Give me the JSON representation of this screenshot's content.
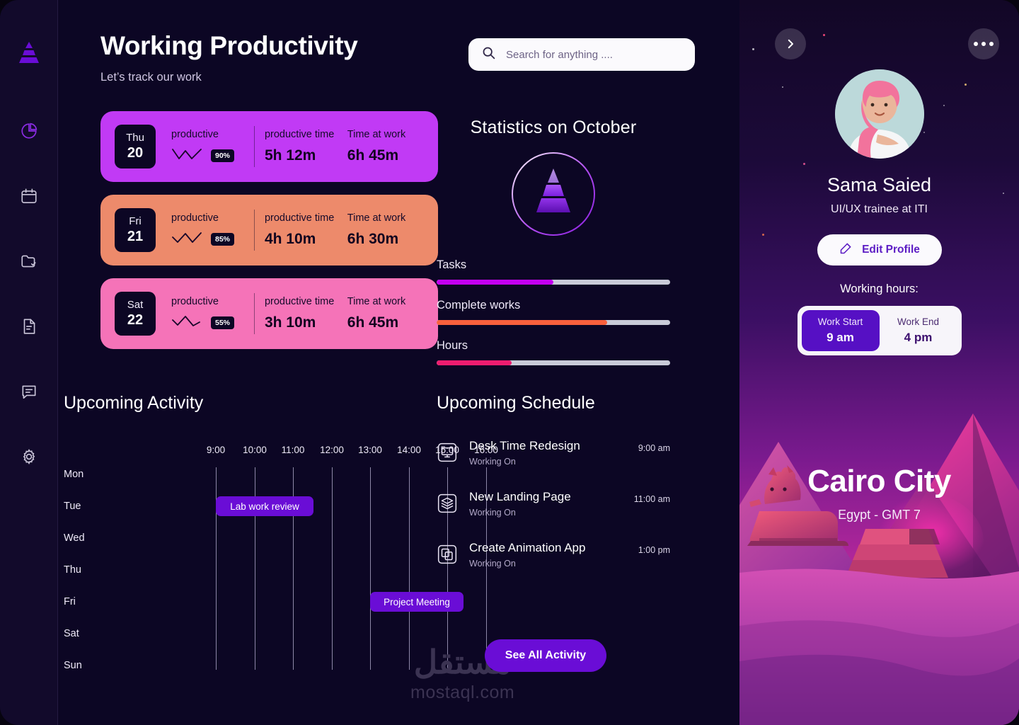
{
  "sidebar": {
    "logo_icon": "pyramid-logo-icon",
    "items": [
      {
        "icon": "pie-chart-icon",
        "active": true
      },
      {
        "icon": "calendar-icon",
        "active": false
      },
      {
        "icon": "folder-check-icon",
        "active": false
      },
      {
        "icon": "document-icon",
        "active": false
      },
      {
        "icon": "chat-icon",
        "active": false
      },
      {
        "icon": "gear-icon",
        "active": false
      }
    ]
  },
  "header": {
    "title": "Working Productivity",
    "subtitle": "Let’s track our work"
  },
  "search": {
    "placeholder": "Search for anything ....",
    "value": "",
    "icon": "search-icon"
  },
  "productivity_cards": [
    {
      "day": "Thu",
      "date": "20",
      "productive_label": "productive",
      "percent": "90%",
      "time_label": "productive time",
      "time_value": "5h 12m",
      "work_label": "Time at work",
      "work_value": "6h 45m",
      "color": "#C13AF5"
    },
    {
      "day": "Fri",
      "date": "21",
      "productive_label": "productive",
      "percent": "85%",
      "time_label": "productive time",
      "time_value": "4h 10m",
      "work_label": "Time at work",
      "work_value": "6h 30m",
      "color": "#ED8A6B"
    },
    {
      "day": "Sat",
      "date": "22",
      "productive_label": "productive",
      "percent": "55%",
      "time_label": "productive time",
      "time_value": "3h 10m",
      "work_label": "Time at work",
      "work_value": "6h 45m",
      "color": "#F573B8"
    }
  ],
  "statistics": {
    "title": "Statistics on October",
    "emblem_icon": "pyramid-emblem-icon",
    "bars": [
      {
        "label": "Tasks",
        "percent": 50,
        "color": "#C300F0"
      },
      {
        "label": "Complete works",
        "percent": 73,
        "color": "#F9603D"
      },
      {
        "label": "Hours",
        "percent": 32,
        "color": "#ED1C6F"
      }
    ],
    "track_color": "#C9CBD8"
  },
  "activity": {
    "title": "Upcoming Activity",
    "hours": [
      "9:00",
      "10:00",
      "11:00",
      "12:00",
      "13:00",
      "14:00",
      "15:00",
      "16:00"
    ],
    "days": [
      "Mon",
      "Tue",
      "Wed",
      "Thu",
      "Fri",
      "Sat",
      "Sun"
    ],
    "events": [
      {
        "label": "Lab work review",
        "day": "Tue",
        "start": "9:00",
        "end": "11:00"
      },
      {
        "label": "Project Meeting",
        "day": "Fri",
        "start": "13:00",
        "end": "15:00"
      }
    ],
    "event_color": "#6A0DD6"
  },
  "schedule": {
    "title": "Upcoming Schedule",
    "items": [
      {
        "name": "Desk Time Redesign",
        "status": "Working On",
        "time": "9:00 am",
        "icon": "monitor-icon"
      },
      {
        "name": "New Landing Page",
        "status": "Working On",
        "time": "11:00 am",
        "icon": "layers-icon"
      },
      {
        "name": "Create Animation App",
        "status": "Working On",
        "time": "1:00 pm",
        "icon": "copy-icon"
      }
    ],
    "see_all_label": "See All Activity"
  },
  "watermark": {
    "arabic": "مستقل",
    "latin": "mostaql.com"
  },
  "profile": {
    "forward_icon": "chevron-right-icon",
    "more_icon": "more-dots-icon",
    "avatar_icon": "user-avatar",
    "name": "Sama Saied",
    "role": "UI/UX trainee at  ITI",
    "edit_label": "Edit Profile",
    "edit_icon": "edit-pencil-icon",
    "working_hours_label": "Working hours:",
    "work_start": {
      "label": "Work Start",
      "value": "9 am"
    },
    "work_end": {
      "label": "Work End",
      "value": "4 pm"
    },
    "city": "Cairo City",
    "city_sub": "Egypt - GMT 7"
  }
}
